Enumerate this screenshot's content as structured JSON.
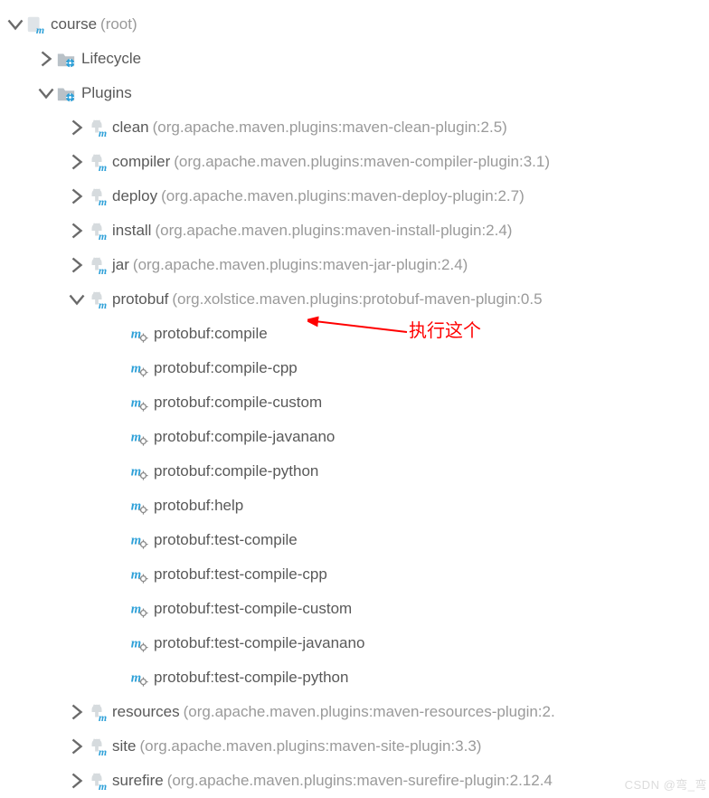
{
  "root": {
    "name": "course",
    "suffix": "(root)"
  },
  "lifecycle_label": "Lifecycle",
  "plugins_label": "Plugins",
  "plugins": [
    {
      "name": "clean",
      "detail": "(org.apache.maven.plugins:maven-clean-plugin:2.5)",
      "expanded": false,
      "goals": []
    },
    {
      "name": "compiler",
      "detail": "(org.apache.maven.plugins:maven-compiler-plugin:3.1)",
      "expanded": false,
      "goals": []
    },
    {
      "name": "deploy",
      "detail": "(org.apache.maven.plugins:maven-deploy-plugin:2.7)",
      "expanded": false,
      "goals": []
    },
    {
      "name": "install",
      "detail": "(org.apache.maven.plugins:maven-install-plugin:2.4)",
      "expanded": false,
      "goals": []
    },
    {
      "name": "jar",
      "detail": "(org.apache.maven.plugins:maven-jar-plugin:2.4)",
      "expanded": false,
      "goals": []
    },
    {
      "name": "protobuf",
      "detail": "(org.xolstice.maven.plugins:protobuf-maven-plugin:0.5",
      "expanded": true,
      "goals": [
        "protobuf:compile",
        "protobuf:compile-cpp",
        "protobuf:compile-custom",
        "protobuf:compile-javanano",
        "protobuf:compile-python",
        "protobuf:help",
        "protobuf:test-compile",
        "protobuf:test-compile-cpp",
        "protobuf:test-compile-custom",
        "protobuf:test-compile-javanano",
        "protobuf:test-compile-python"
      ]
    },
    {
      "name": "resources",
      "detail": "(org.apache.maven.plugins:maven-resources-plugin:2.",
      "expanded": false,
      "goals": []
    },
    {
      "name": "site",
      "detail": "(org.apache.maven.plugins:maven-site-plugin:3.3)",
      "expanded": false,
      "goals": []
    },
    {
      "name": "surefire",
      "detail": "(org.apache.maven.plugins:maven-surefire-plugin:2.12.4",
      "expanded": false,
      "goals": []
    }
  ],
  "annotation_text": "执行这个",
  "watermark": "CSDN @弯_弯"
}
